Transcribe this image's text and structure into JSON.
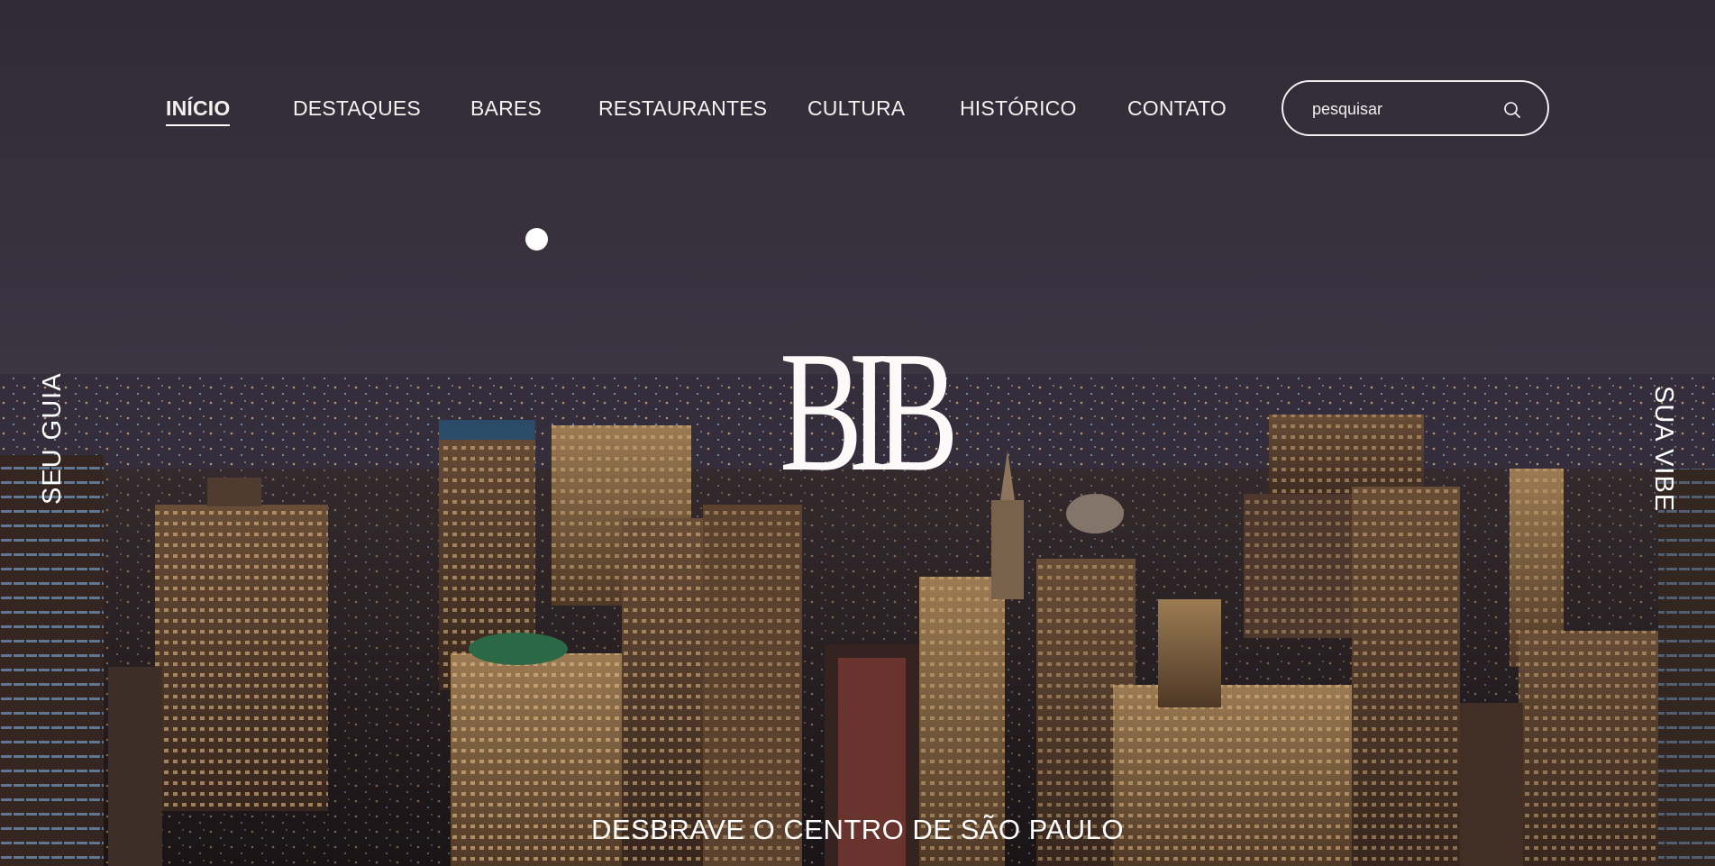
{
  "nav": {
    "items": [
      {
        "label": "INÍCIO",
        "active": true
      },
      {
        "label": "DESTAQUES",
        "active": false
      },
      {
        "label": "BARES",
        "active": false
      },
      {
        "label": "RESTAURANTES",
        "active": false
      },
      {
        "label": "CULTURA",
        "active": false
      },
      {
        "label": "HISTÓRICO",
        "active": false
      },
      {
        "label": "CONTATO",
        "active": false
      }
    ]
  },
  "search": {
    "placeholder": "pesquisar",
    "value": "",
    "icon": "search-icon"
  },
  "hero": {
    "logo_text": "BIB",
    "side_left": "SEU GUIA",
    "side_right": "SUA VIBE",
    "tagline": "DESBRAVE O CENTRO DE SÃO PAULO",
    "background": "night-city-skyline"
  },
  "colors": {
    "sky_top": "#35313c",
    "sky_bottom": "#4a4453",
    "text": "#ffffff",
    "city_warm": "#e0a25a",
    "city_cool": "#7fb6ff"
  }
}
